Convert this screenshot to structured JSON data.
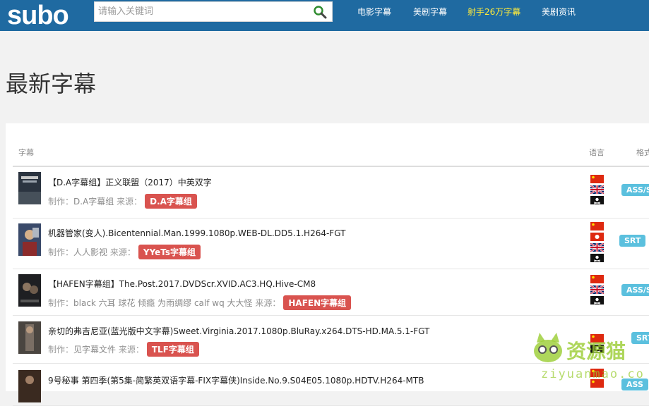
{
  "header": {
    "logo_text": "subo",
    "search": {
      "placeholder": "请输入关键词",
      "value": ""
    },
    "nav": [
      {
        "label": "电影字幕",
        "highlight": false
      },
      {
        "label": "美剧字幕",
        "highlight": false
      },
      {
        "label": "射手26万字幕",
        "highlight": true
      },
      {
        "label": "美剧资讯",
        "highlight": false
      }
    ],
    "highlight_color": "#ffeb3b",
    "bar_color": "#1f6aa1"
  },
  "page_title": "最新字幕",
  "table": {
    "columns": {
      "subtitle": "字幕",
      "language": "语言",
      "format": "格式"
    },
    "meta_label": "制作：",
    "source_label": "来源：",
    "rows": [
      {
        "title": "【D.A字幕组】正义联盟（2017）中英双字",
        "credits": "D.A字幕组",
        "source": "D.A字幕组",
        "languages": [
          "cn",
          "uk",
          "pirate"
        ],
        "format": "ASS/S"
      },
      {
        "title": "机器管家(变人).Bicentennial.Man.1999.1080p.WEB-DL.DD5.1.H264-FGT",
        "credits": "人人影视",
        "source": "YYeTs字幕组",
        "languages": [
          "cn",
          "hk",
          "uk",
          "pirate"
        ],
        "format": "SRT"
      },
      {
        "title": "【HAFEN字幕组】The.Post.2017.DVDScr.XVID.AC3.HQ.Hive-CM8",
        "credits": "black 六耳 球花 倾瘾 为雨绸缪 calf wq 大大怪",
        "source": "HAFEN字幕组",
        "languages": [
          "cn",
          "uk",
          "pirate"
        ],
        "format": "ASS/S"
      },
      {
        "title": "亲切的弗吉尼亚(蓝光版中文字幕)Sweet.Virginia.2017.1080p.BluRay.x264.DTS-HD.MA.5.1-FGT",
        "credits": "见字幕文件",
        "source": "TLF字幕组",
        "languages": [
          "cn",
          "pirate"
        ],
        "format": "SRT"
      },
      {
        "title": "9号秘事 第四季(第5集-简繁英双语字幕-FIX字幕侠)Inside.No.9.S04E05.1080p.HDTV.H264-MTB",
        "credits": "",
        "source": "",
        "languages": [
          "cn"
        ],
        "format": "ASS"
      }
    ],
    "badge_color": "#d9534f",
    "format_badge_color": "#5bc0de"
  },
  "watermark": {
    "text": "资源猫",
    "url_text": "ziyuanmao.com"
  }
}
